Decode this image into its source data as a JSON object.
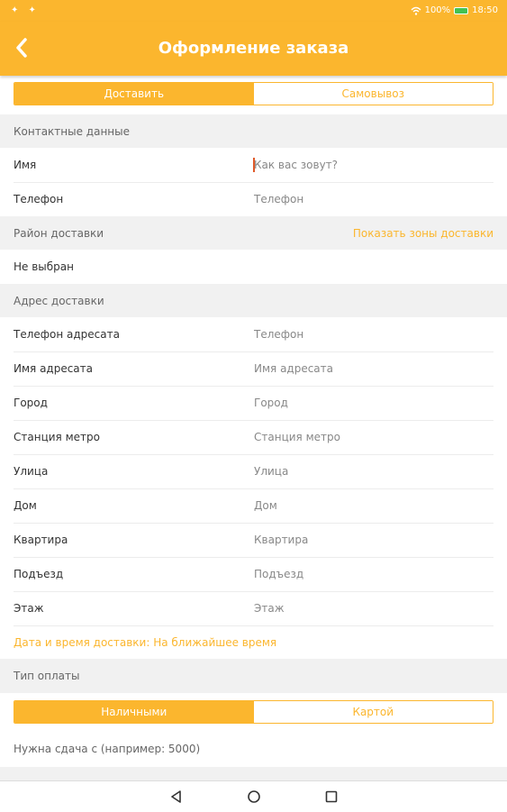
{
  "statusbar": {
    "left_icons": "✦ ✦",
    "battery_text": "100%",
    "time": "18:50"
  },
  "header": {
    "title": "Оформление заказа"
  },
  "delivery_toggle": {
    "deliver_label": "Доставить",
    "pickup_label": "Самовывоз"
  },
  "contacts": {
    "section_title": "Контактные данные",
    "name_label": "Имя",
    "name_placeholder": "Как вас зовут?",
    "phone_label": "Телефон",
    "phone_placeholder": "Телефон"
  },
  "district": {
    "section_title": "Район доставки",
    "zones_link": "Показать зоны доставки",
    "value": "Не выбран"
  },
  "address": {
    "section_title": "Адрес доставки",
    "rows": [
      {
        "label": "Телефон адресата",
        "placeholder": "Телефон"
      },
      {
        "label": "Имя адресата",
        "placeholder": "Имя адресата"
      },
      {
        "label": "Город",
        "placeholder": "Город"
      },
      {
        "label": "Станция метро",
        "placeholder": "Станция метро"
      },
      {
        "label": "Улица",
        "placeholder": "Улица"
      },
      {
        "label": "Дом",
        "placeholder": "Дом"
      },
      {
        "label": "Квартира",
        "placeholder": "Квартира"
      },
      {
        "label": "Подъезд",
        "placeholder": "Подъезд"
      },
      {
        "label": "Этаж",
        "placeholder": "Этаж"
      }
    ],
    "datetime_text": "Дата и время доставки: На ближайшее время"
  },
  "payment": {
    "section_title": "Тип оплаты",
    "cash_label": "Наличными",
    "card_label": "Картой",
    "change_text": "Нужна сдача с (например: 5000)"
  },
  "navigation": {
    "icons": [
      "back-triangle",
      "home-circle",
      "recents-square"
    ]
  },
  "colors": {
    "accent": "#fbb62e",
    "section_bg": "#f1f1f1",
    "cursor": "#e05a2a"
  }
}
